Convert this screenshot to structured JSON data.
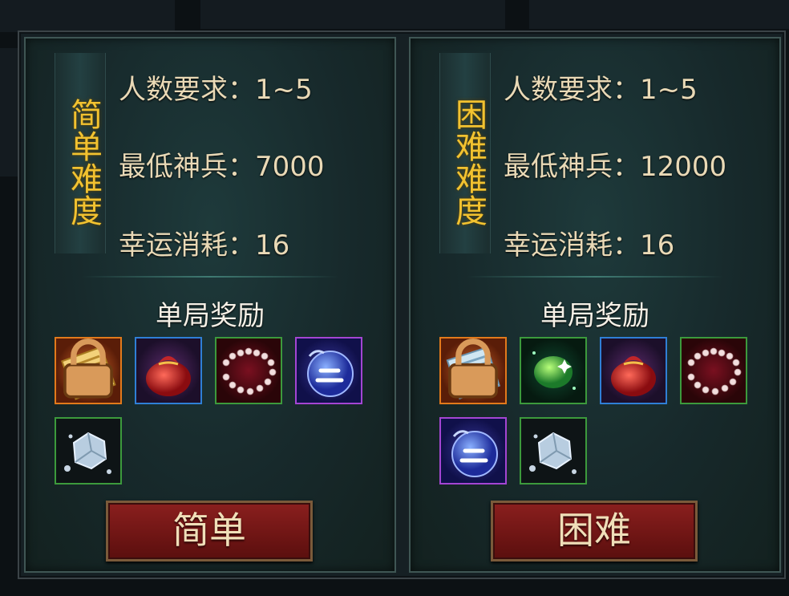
{
  "panels": [
    {
      "difficulty_label": "简单难度",
      "requirements": [
        {
          "text": "人数要求：1~5"
        },
        {
          "text": "最低神兵：7000"
        },
        {
          "text": "幸运消耗：16"
        }
      ],
      "reward_title": "单局奖励",
      "rewards": [
        {
          "icon": "golden-scroll-icon",
          "border": "orange",
          "locked": true
        },
        {
          "icon": "red-pouch-icon",
          "border": "blue",
          "locked": false
        },
        {
          "icon": "pearl-necklace-icon",
          "border": "green",
          "locked": false
        },
        {
          "icon": "blue-orb-icon",
          "border": "purple",
          "locked": false
        },
        {
          "icon": "silver-ore-icon",
          "border": "green",
          "locked": false
        }
      ],
      "button_label": "简单"
    },
    {
      "difficulty_label": "困难难度",
      "requirements": [
        {
          "text": "人数要求：1~5"
        },
        {
          "text": "最低神兵：12000"
        },
        {
          "text": "幸运消耗：16"
        }
      ],
      "reward_title": "单局奖励",
      "rewards": [
        {
          "icon": "blue-scroll-icon",
          "border": "orange",
          "locked": true
        },
        {
          "icon": "green-gem-icon",
          "border": "green",
          "locked": false
        },
        {
          "icon": "red-pouch-icon",
          "border": "blue",
          "locked": false
        },
        {
          "icon": "pearl-necklace-icon",
          "border": "green",
          "locked": false
        },
        {
          "icon": "blue-orb-icon",
          "border": "purple",
          "locked": false
        },
        {
          "icon": "silver-ore-icon",
          "border": "green",
          "locked": false
        }
      ],
      "button_label": "困难"
    }
  ],
  "colors": {
    "difficulty_text": "#f2c230",
    "requirement_text": "#e9d9b6",
    "button_bg": "#7a1a19",
    "button_text": "#f0dfb9"
  }
}
